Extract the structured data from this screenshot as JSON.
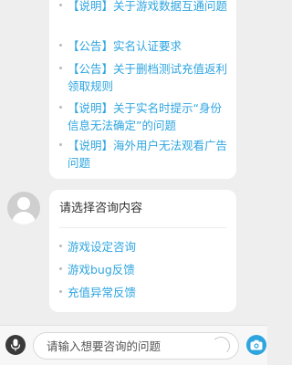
{
  "notices": [
    {
      "text": "【说明】关于游戏数据互通问题"
    },
    {
      "text": "【公告】实名认证要求"
    },
    {
      "text": "【公告】关于删档测试充值返利领取规则"
    },
    {
      "text": "【说明】关于实名时提示“身份信息无法确定”的问题"
    },
    {
      "text": "【说明】海外用户无法观看广告问题"
    }
  ],
  "menu": {
    "title": "请选择咨询内容",
    "items": [
      {
        "label": "游戏设定咨询"
      },
      {
        "label": "游戏bug反馈"
      },
      {
        "label": "充值异常反馈"
      }
    ]
  },
  "input_bar": {
    "placeholder": "请输入想要咨询的问题"
  },
  "colors": {
    "link": "#2fa5e0",
    "background": "#eeeeee",
    "bubble": "#ffffff",
    "camera_button": "#2fa5e0"
  },
  "icons": {
    "mic": "microphone-icon",
    "camera": "camera-icon",
    "avatar": "user-avatar"
  }
}
